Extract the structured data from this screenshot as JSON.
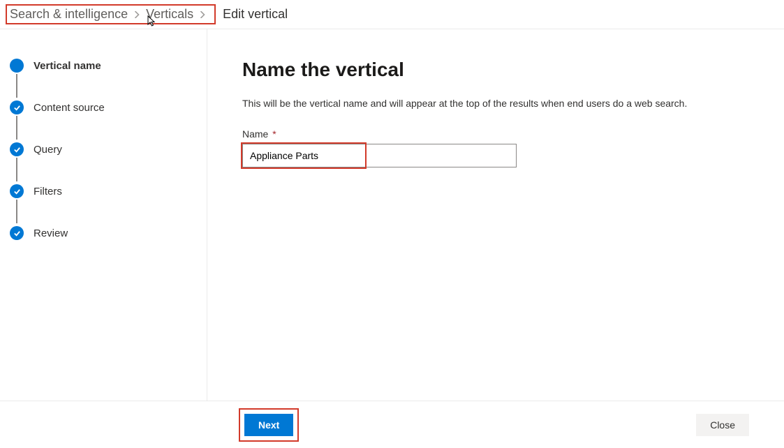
{
  "breadcrumb": {
    "items": [
      {
        "label": "Search & intelligence"
      },
      {
        "label": "Verticals"
      }
    ],
    "current": "Edit vertical"
  },
  "sidebar": {
    "steps": [
      {
        "label": "Vertical name",
        "state": "active"
      },
      {
        "label": "Content source",
        "state": "completed"
      },
      {
        "label": "Query",
        "state": "completed"
      },
      {
        "label": "Filters",
        "state": "completed"
      },
      {
        "label": "Review",
        "state": "completed"
      }
    ]
  },
  "main": {
    "heading": "Name the vertical",
    "description": "This will be the vertical name and will appear at the top of the results when end users do a web search.",
    "name_field": {
      "label": "Name",
      "required_marker": "*",
      "value": "Appliance Parts"
    }
  },
  "footer": {
    "next_label": "Next",
    "close_label": "Close"
  },
  "colors": {
    "primary": "#0078d4",
    "highlight": "#d23a2a"
  }
}
